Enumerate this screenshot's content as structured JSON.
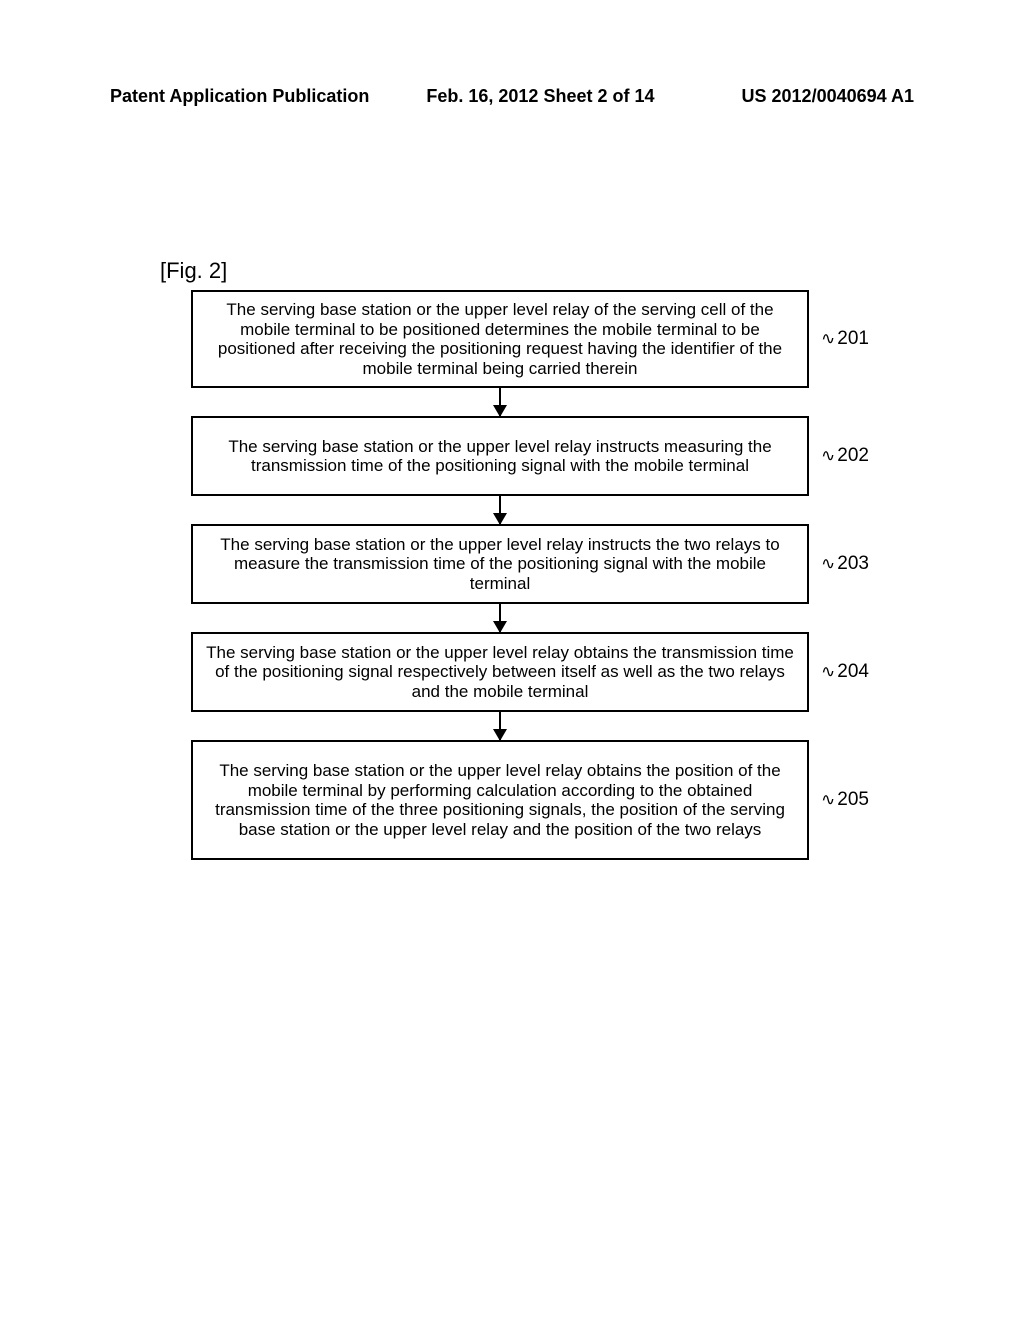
{
  "header": {
    "left": "Patent Application Publication",
    "center": "Feb. 16, 2012 Sheet 2 of 14",
    "right": "US 2012/0040694 A1"
  },
  "figure_label": "[Fig. 2]",
  "steps": [
    {
      "text": "The serving base station or the upper level relay of the serving cell of the mobile terminal to be positioned determines the mobile terminal to be positioned after receiving the positioning request having the identifier of the mobile terminal being carried therein",
      "ref": "201"
    },
    {
      "text": "The serving base station or the upper level relay instructs measuring the transmission time of the positioning signal with the mobile terminal",
      "ref": "202"
    },
    {
      "text": "The serving base station or the upper level relay instructs the two relays to measure the transmission time of the positioning signal with the mobile terminal",
      "ref": "203"
    },
    {
      "text": "The serving base station or the upper level relay obtains the transmission time of the positioning signal respectively between itself as well as the two relays and the mobile terminal",
      "ref": "204"
    },
    {
      "text": "The serving base station or the upper level relay obtains the position of the mobile terminal by performing calculation according to the obtained transmission time of the three positioning signals, the position of the serving base station or the upper level relay and the position of the two relays",
      "ref": "205"
    }
  ]
}
